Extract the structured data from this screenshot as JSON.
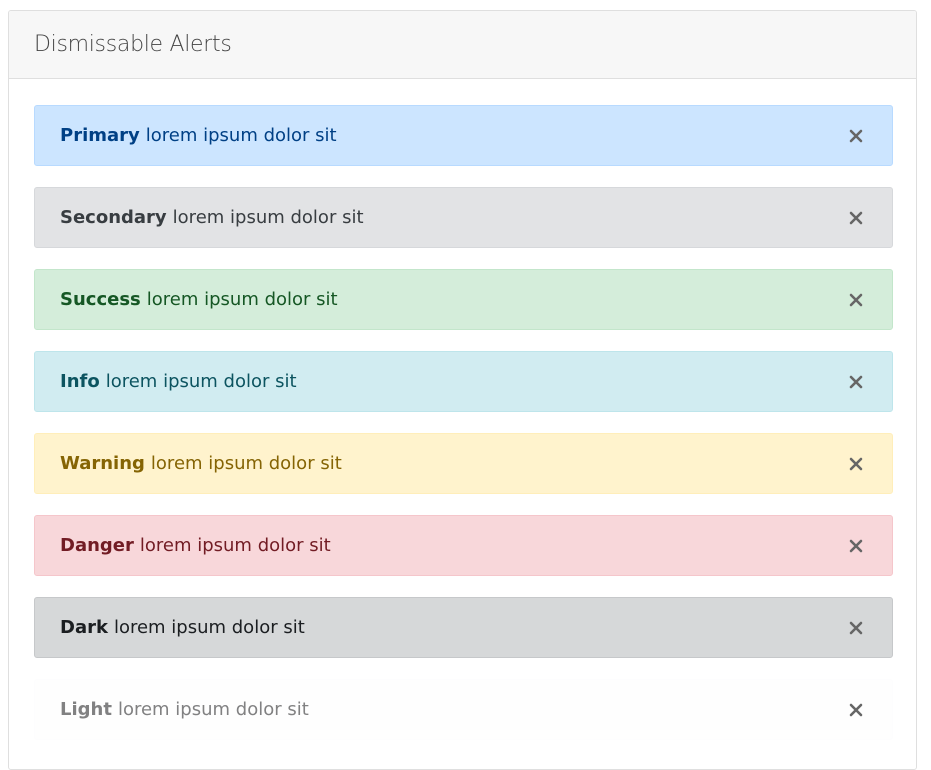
{
  "card": {
    "title": "Dismissable Alerts"
  },
  "alerts": [
    {
      "variant": "primary",
      "label": "Primary",
      "text": "lorem ipsum dolor sit",
      "close_icon": "close-icon"
    },
    {
      "variant": "secondary",
      "label": "Secondary",
      "text": "lorem ipsum dolor sit",
      "close_icon": "close-icon"
    },
    {
      "variant": "success",
      "label": "Success",
      "text": "lorem ipsum dolor sit",
      "close_icon": "close-icon"
    },
    {
      "variant": "info",
      "label": "Info",
      "text": "lorem ipsum dolor sit",
      "close_icon": "close-icon"
    },
    {
      "variant": "warning",
      "label": "Warning",
      "text": "lorem ipsum dolor sit",
      "close_icon": "close-icon"
    },
    {
      "variant": "danger",
      "label": "Danger",
      "text": "lorem ipsum dolor sit",
      "close_icon": "close-icon"
    },
    {
      "variant": "dark",
      "label": "Dark",
      "text": "lorem ipsum dolor sit",
      "close_icon": "close-icon"
    },
    {
      "variant": "light",
      "label": "Light",
      "text": "lorem ipsum dolor sit",
      "close_icon": "close-icon"
    }
  ],
  "colors": {
    "primary_bg": "#cce5ff",
    "secondary_bg": "#e2e3e5",
    "success_bg": "#d4edda",
    "info_bg": "#d1ecf1",
    "warning_bg": "#fff3cd",
    "danger_bg": "#f8d7da",
    "dark_bg": "#d6d8d9",
    "light_bg": "#fefefe",
    "close_icon": "#666666"
  }
}
